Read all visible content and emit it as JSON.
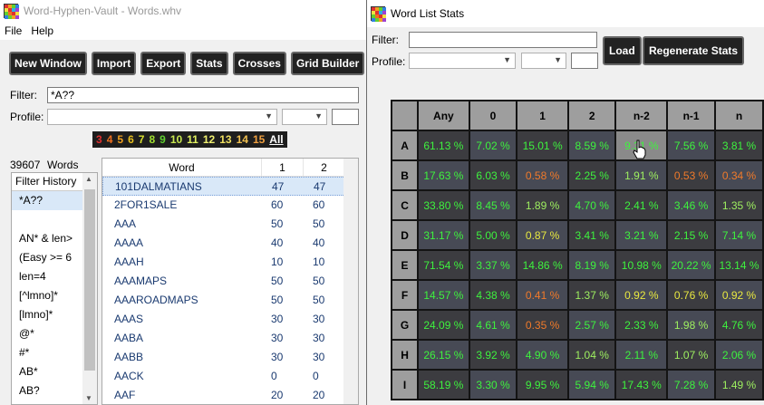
{
  "main_window": {
    "title": "Word-Hyphen-Vault - Words.whv",
    "menu": [
      "File",
      "Help"
    ],
    "toolbar": [
      "New Window",
      "Import",
      "Export",
      "Stats",
      "Crosses",
      "Grid Builder"
    ],
    "filter_label": "Filter:",
    "filter_value": "*A??",
    "profile_label": "Profile:",
    "lengths": [
      {
        "label": "3",
        "color": "#e03030"
      },
      {
        "label": "4",
        "color": "#f07020"
      },
      {
        "label": "5",
        "color": "#f0a020"
      },
      {
        "label": "6",
        "color": "#e8c020"
      },
      {
        "label": "7",
        "color": "#d8e030"
      },
      {
        "label": "8",
        "color": "#a0e030"
      },
      {
        "label": "9",
        "color": "#60d030"
      },
      {
        "label": "10",
        "color": "#c8e850"
      },
      {
        "label": "11",
        "color": "#e0f060"
      },
      {
        "label": "12",
        "color": "#f0f070"
      },
      {
        "label": "13",
        "color": "#f0e060"
      },
      {
        "label": "14",
        "color": "#f0c050"
      },
      {
        "label": "15",
        "color": "#f0a040"
      },
      {
        "label": "All",
        "color": "#ffffff"
      }
    ],
    "word_count": "39607",
    "word_count_label": "Words",
    "history_header": "Filter History",
    "history": [
      "*A??",
      "",
      "AN* & len>",
      "(Easy >= 6",
      "len=4",
      "[^lmno]*",
      "[lmno]*",
      "@*",
      "#*",
      "AB*",
      "AB?"
    ],
    "list_headers": [
      "Word",
      "1",
      "2"
    ],
    "words": [
      [
        "101DALMATIANS",
        "47",
        "47"
      ],
      [
        "2FOR1SALE",
        "60",
        "60"
      ],
      [
        "AAA",
        "50",
        "50"
      ],
      [
        "AAAA",
        "40",
        "40"
      ],
      [
        "AAAH",
        "10",
        "10"
      ],
      [
        "AAAMAPS",
        "50",
        "50"
      ],
      [
        "AAAROADMAPS",
        "50",
        "50"
      ],
      [
        "AAAS",
        "30",
        "30"
      ],
      [
        "AABA",
        "30",
        "30"
      ],
      [
        "AABB",
        "30",
        "30"
      ],
      [
        "AACK",
        "0",
        "0"
      ],
      [
        "AAF",
        "20",
        "20"
      ]
    ]
  },
  "stats_window": {
    "title": "Word List Stats",
    "filter_label": "Filter:",
    "filter_value": "",
    "profile_label": "Profile:",
    "load_button": "Load",
    "regen_button": "Regenerate Stats",
    "columns": [
      "Any",
      "0",
      "1",
      "2",
      "n-2",
      "n-1",
      "n"
    ],
    "rows": [
      {
        "letter": "A",
        "cells": [
          "61.13 %",
          "7.02 %",
          "15.01 %",
          "8.59 %",
          "9.31 %",
          "7.56 %",
          "3.81 %"
        ]
      },
      {
        "letter": "B",
        "cells": [
          "17.63 %",
          "6.03 %",
          "0.58 %",
          "2.25 %",
          "1.91 %",
          "0.53 %",
          "0.34 %"
        ]
      },
      {
        "letter": "C",
        "cells": [
          "33.80 %",
          "8.45 %",
          "1.89 %",
          "4.70 %",
          "2.41 %",
          "3.46 %",
          "1.35 %"
        ]
      },
      {
        "letter": "D",
        "cells": [
          "31.17 %",
          "5.00 %",
          "0.87 %",
          "3.41 %",
          "3.21 %",
          "2.15 %",
          "7.14 %"
        ]
      },
      {
        "letter": "E",
        "cells": [
          "71.54 %",
          "3.37 %",
          "14.86 %",
          "8.19 %",
          "10.98 %",
          "20.22 %",
          "13.14 %"
        ]
      },
      {
        "letter": "F",
        "cells": [
          "14.57 %",
          "4.38 %",
          "0.41 %",
          "1.37 %",
          "0.92 %",
          "0.76 %",
          "0.92 %"
        ]
      },
      {
        "letter": "G",
        "cells": [
          "24.09 %",
          "4.61 %",
          "0.35 %",
          "2.57 %",
          "2.33 %",
          "1.98 %",
          "4.76 %"
        ]
      },
      {
        "letter": "H",
        "cells": [
          "26.15 %",
          "3.92 %",
          "4.90 %",
          "1.04 %",
          "2.11 %",
          "1.07 %",
          "2.06 %"
        ]
      },
      {
        "letter": "I",
        "cells": [
          "58.19 %",
          "3.30 %",
          "9.95 %",
          "5.94 %",
          "17.43 %",
          "7.28 %",
          "1.49 %"
        ]
      }
    ]
  }
}
